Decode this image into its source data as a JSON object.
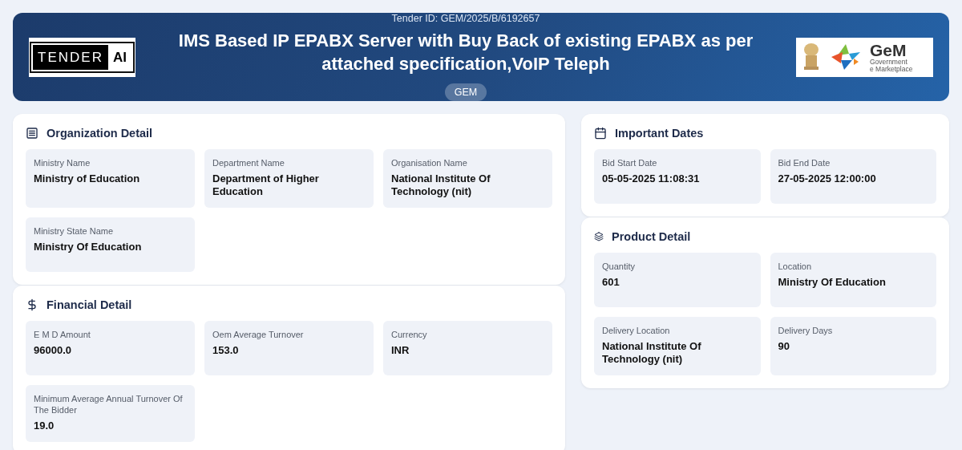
{
  "header": {
    "logo": {
      "word": "TENDER",
      "badge": "AI"
    },
    "tender_id": "Tender ID: GEM/2025/B/6192657",
    "title": "IMS Based IP EPABX Server with Buy Back of existing EPABX as per attached specification,VoIP Teleph",
    "tag": "GEM",
    "partner_logo": {
      "name": "GeM",
      "line_1": "Government",
      "line_2": "e Marketplace"
    }
  },
  "left_sections": [
    {
      "kind": "list",
      "title": "Organization Detail",
      "fields": [
        {
          "label": "Ministry Name",
          "value": "Ministry of Education"
        },
        {
          "label": "Department Name",
          "value": "Department of Higher Education"
        },
        {
          "label": "Organisation Name",
          "value": "National Institute Of Technology (nit)"
        },
        {
          "label": "Ministry State Name",
          "value": "Ministry Of Education"
        }
      ]
    },
    {
      "kind": "dollar",
      "title": "Financial Detail",
      "fields": [
        {
          "label": "E M D Amount",
          "value": "96000.0"
        },
        {
          "label": "Oem Average Turnover",
          "value": "153.0"
        },
        {
          "label": "Currency",
          "value": "INR"
        },
        {
          "label": "Minimum Average Annual Turnover Of The Bidder",
          "value": "19.0"
        }
      ]
    }
  ],
  "right_sections": [
    {
      "kind": "calendar",
      "title": "Important Dates",
      "fields": [
        {
          "label": "Bid Start Date",
          "value": "05-05-2025 11:08:31"
        },
        {
          "label": "Bid End Date",
          "value": "27-05-2025 12:00:00"
        }
      ]
    },
    {
      "kind": "layers",
      "title": "Product Detail",
      "fields": [
        {
          "label": "Quantity",
          "value": "601"
        },
        {
          "label": "Location",
          "value": "Ministry Of Education"
        },
        {
          "label": "Delivery Location",
          "value": "National Institute Of Technology (nit)"
        },
        {
          "label": "Delivery Days",
          "value": "90"
        }
      ]
    }
  ]
}
